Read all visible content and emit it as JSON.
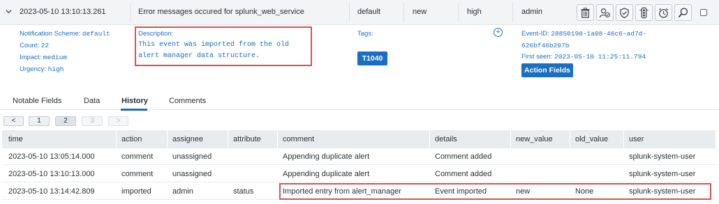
{
  "header": {
    "time": "2023-05-10 13:10:13.261",
    "title": "Error messages occured for splunk_web_service",
    "app": "default",
    "status": "new",
    "urgency": "high",
    "owner": "admin"
  },
  "details": {
    "notification_scheme_label": "Notification Scheme:",
    "notification_scheme_value": "default",
    "count_label": "Count:",
    "count_value": "22",
    "impact_label": "Impact:",
    "impact_value": "medium",
    "urgency_label": "Urgency:",
    "urgency_value": "high",
    "description_label": "Description:",
    "description_text": "This event was imported from the old alert manager data structure.",
    "tags_label": "Tags:",
    "tag": "T1040",
    "event_id_label": "Event-ID:",
    "event_id_line1": "28850190-1a08-46c6-ad7d-",
    "event_id_line2": "626bf46b207b",
    "first_seen_label": "First seen:",
    "first_seen_value": "2023-05-10 11:25:11.794",
    "action_fields_label": "Action Fields"
  },
  "tabs": [
    "Notable Fields",
    "Data",
    "History",
    "Comments"
  ],
  "active_tab": "History",
  "pagination": {
    "prev": "<",
    "pages": [
      "1",
      "2",
      "3"
    ],
    "current": "2",
    "next": ">"
  },
  "table": {
    "columns": [
      "time",
      "action",
      "assignee",
      "attribute",
      "comment",
      "details",
      "new_value",
      "old_value",
      "user"
    ],
    "rows": [
      [
        "2023-05-10 13:05:14.000",
        "comment",
        "unassigned",
        "",
        "Appending duplicate alert",
        "Comment added",
        "",
        "",
        "splunk-system-user"
      ],
      [
        "2023-05-10 13:10:13.000",
        "comment",
        "unassigned",
        "",
        "Appending duplicate alert",
        "Comment added",
        "",
        "",
        "splunk-system-user"
      ],
      [
        "2023-05-10 13:14:42.809",
        "imported",
        "admin",
        "status",
        "Imported entry from alert_manager",
        "Event imported",
        "new",
        "None",
        "splunk-system-user"
      ]
    ]
  },
  "icons": [
    "trash-icon",
    "assign-user-icon",
    "acknowledge-icon",
    "traffic-light-icon",
    "snooze-icon",
    "search-icon"
  ],
  "colors": {
    "accent": "#1a6fc4",
    "highlight": "#d9534f",
    "header_bg": "#f2f4f5",
    "table_header_bg": "#e9ecee"
  }
}
